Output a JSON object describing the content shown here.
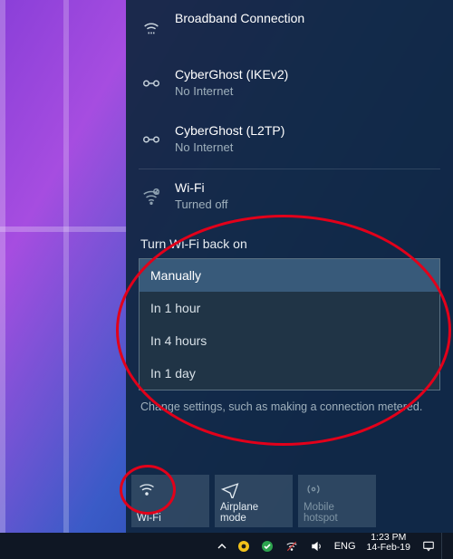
{
  "networks": [
    {
      "name": "Broadband Connection",
      "status": "",
      "kind": "dialup"
    },
    {
      "name": "CyberGhost (IKEv2)",
      "status": "No Internet",
      "kind": "vpn"
    },
    {
      "name": "CyberGhost (L2TP)",
      "status": "No Internet",
      "kind": "vpn"
    }
  ],
  "wifi": {
    "label": "Wi-Fi",
    "status": "Turned off"
  },
  "back_on": {
    "prompt": "Turn Wi-Fi back on",
    "options": [
      "Manually",
      "In 1 hour",
      "In 4 hours",
      "In 1 day"
    ],
    "selected": "Manually"
  },
  "change_text": "Change settings, such as making a connection metered.",
  "tiles": {
    "wifi": "Wi-Fi",
    "airplane": "Airplane mode",
    "hotspot": "Mobile hotspot"
  },
  "tray": {
    "lang": "ENG",
    "time": "1:23 PM",
    "date": "14-Feb-19"
  }
}
